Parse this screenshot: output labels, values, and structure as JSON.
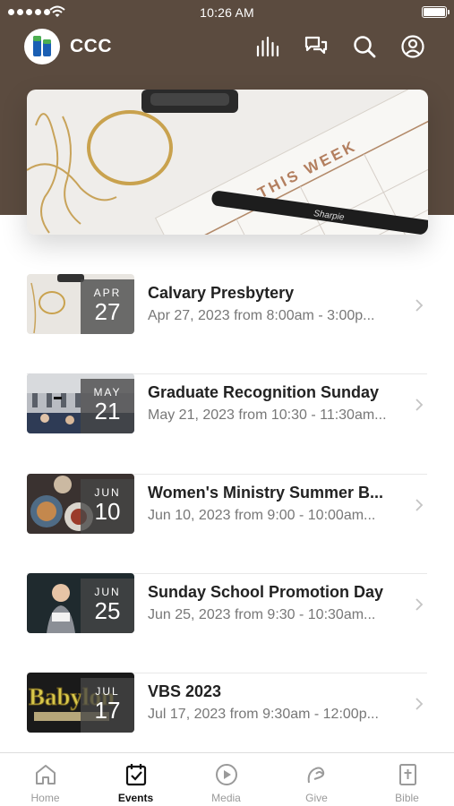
{
  "status_bar": {
    "time": "10:26 AM"
  },
  "header": {
    "title": "CCC"
  },
  "hero": {
    "text": "THIS WEEK"
  },
  "events": [
    {
      "month": "APR",
      "day": "27",
      "title": "Calvary Presbytery",
      "subtitle": "Apr 27, 2023 from 8:00am - 3:00p..."
    },
    {
      "month": "MAY",
      "day": "21",
      "title": "Graduate Recognition Sunday",
      "subtitle": "May 21, 2023 from 10:30 - 11:30am..."
    },
    {
      "month": "JUN",
      "day": "10",
      "title": "Women's Ministry Summer B...",
      "subtitle": "Jun 10, 2023 from 9:00 - 10:00am..."
    },
    {
      "month": "JUN",
      "day": "25",
      "title": "Sunday School Promotion Day",
      "subtitle": "Jun 25, 2023 from 9:30 - 10:30am..."
    },
    {
      "month": "JUL",
      "day": "17",
      "title": "VBS 2023",
      "subtitle": "Jul 17, 2023 from 9:30am - 12:00p...",
      "thumb_text": "Babylon"
    }
  ],
  "tabs": [
    {
      "label": "Home",
      "icon": "home-icon"
    },
    {
      "label": "Events",
      "icon": "calendar-check-icon",
      "active": true
    },
    {
      "label": "Media",
      "icon": "play-icon"
    },
    {
      "label": "Give",
      "icon": "give-icon"
    },
    {
      "label": "Bible",
      "icon": "bible-icon"
    }
  ],
  "colors": {
    "header_bg": "#5b4b3f",
    "tab_inactive": "#9a9a9a",
    "tab_active": "#111111",
    "logo_blue": "#1a5fb4",
    "logo_green": "#4caf50"
  }
}
